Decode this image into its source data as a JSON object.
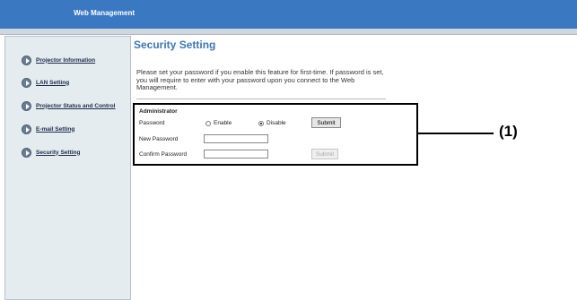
{
  "header": {
    "title": "Web Management"
  },
  "sidebar": {
    "items": [
      {
        "label": "Projector Information"
      },
      {
        "label": "LAN Setting"
      },
      {
        "label": "Projector Status and Control"
      },
      {
        "label": "E-mail Setting"
      },
      {
        "label": "Security Setting"
      }
    ]
  },
  "main": {
    "title": "Security Setting",
    "intro": "Please set your password if you enable this feature for first-time. If password is set, you will require to enter with your password upon you connect to the Web Management.",
    "section_title": "Administrator",
    "password": {
      "label": "Password",
      "enable_label": "Enable",
      "disable_label": "Disable",
      "selected": "Disable",
      "submit_label": "Submit"
    },
    "new_password": {
      "label": "New Password",
      "value": ""
    },
    "confirm_password": {
      "label": "Confirm Password",
      "value": ""
    },
    "confirm_submit_label": "Submit"
  },
  "callout": {
    "label": "(1)"
  }
}
